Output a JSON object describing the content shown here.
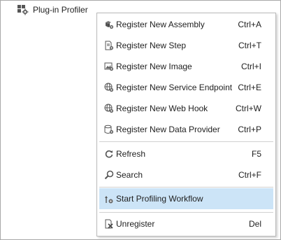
{
  "tree": {
    "node_label": "Plug-in Profiler",
    "node_icon": "plugin-profiler-icon"
  },
  "menu": {
    "items": [
      {
        "label": "Register New Assembly",
        "shortcut": "Ctrl+A",
        "icon": "assembly-icon"
      },
      {
        "label": "Register New Step",
        "shortcut": "Ctrl+T",
        "icon": "step-icon"
      },
      {
        "label": "Register New Image",
        "shortcut": "Ctrl+I",
        "icon": "image-icon"
      },
      {
        "label": "Register New Service Endpoint",
        "shortcut": "Ctrl+E",
        "icon": "service-endpoint-icon"
      },
      {
        "label": "Register New Web Hook",
        "shortcut": "Ctrl+W",
        "icon": "web-hook-icon"
      },
      {
        "label": "Register New Data Provider",
        "shortcut": "Ctrl+P",
        "icon": "data-provider-icon"
      },
      {
        "label": "Refresh",
        "shortcut": "F5",
        "icon": "refresh-icon"
      },
      {
        "label": "Search",
        "shortcut": "Ctrl+F",
        "icon": "search-icon"
      },
      {
        "label": "Start Profiling Workflow",
        "shortcut": "",
        "icon": "profiling-workflow-icon",
        "highlighted": true
      },
      {
        "label": "Unregister",
        "shortcut": "Del",
        "icon": "unregister-icon"
      }
    ]
  },
  "colors": {
    "highlight": "#cce4f7",
    "separator": "#d0d0d0",
    "menu_border": "#b9b9b9"
  }
}
